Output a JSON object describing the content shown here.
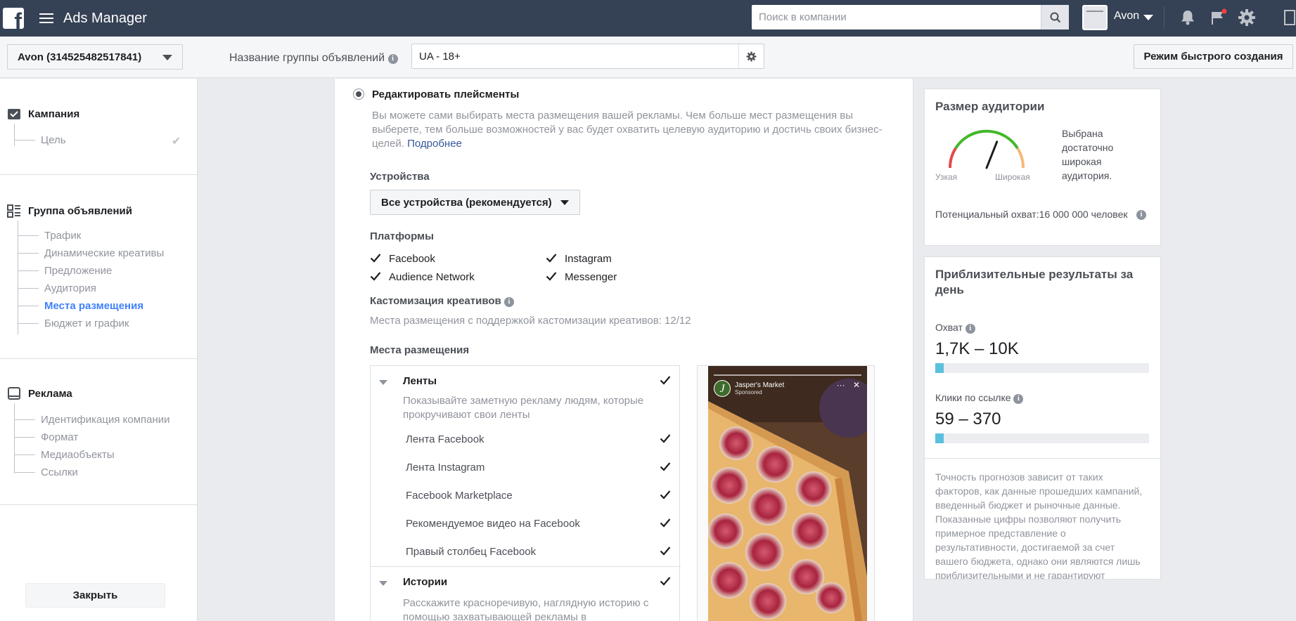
{
  "app": {
    "title": "Ads Manager",
    "search_placeholder": "Поиск в компании",
    "account_name": "Avon"
  },
  "subbar": {
    "account_select": "Avon (314525482517841)",
    "adset_name_label": "Название группы объявлений",
    "adset_name_value": "UA - 18+",
    "quick_create": "Режим быстрого создания"
  },
  "sidebar": {
    "campaign": {
      "title": "Кампания",
      "items": [
        "Цель"
      ]
    },
    "adset": {
      "title": "Группа объявлений",
      "items": [
        "Трафик",
        "Динамические креативы",
        "Предложение",
        "Аудитория",
        "Места размещения",
        "Бюджет и график"
      ],
      "active_index": 4
    },
    "ad": {
      "title": "Реклама",
      "items": [
        "Идентификация компании",
        "Формат",
        "Медиаобъекты",
        "Ссылки"
      ]
    },
    "close_button": "Закрыть"
  },
  "placements": {
    "edit_label": "Редактировать плейсменты",
    "description": "Вы можете сами выбирать места размещения вашей рекламы. Чем больше мест размещения вы выберете, тем больше возможностей у вас будет охватить целевую аудиторию и достичь своих бизнес-целей.",
    "learn_more": "Подробнее",
    "devices_label": "Устройства",
    "devices_value": "Все устройства (рекомендуется)",
    "platforms_label": "Платформы",
    "platforms": [
      {
        "name": "Facebook",
        "checked": true
      },
      {
        "name": "Instagram",
        "checked": true
      },
      {
        "name": "Audience Network",
        "checked": true
      },
      {
        "name": "Messenger",
        "checked": true
      }
    ],
    "custom_label": "Кастомизация креативов",
    "custom_text": "Места размещения с поддержкой кастомизации креативов: 12/12",
    "places_label": "Места размещения",
    "feeds": {
      "title": "Ленты",
      "description": "Показывайте заметную рекламу людям, которые прокручивают свои ленты",
      "items": [
        "Лента Facebook",
        "Лента Instagram",
        "Facebook Marketplace",
        "Рекомендуемое видео на Facebook",
        "Правый столбец Facebook"
      ]
    },
    "stories": {
      "title": "Истории",
      "description": "Расскажите красноречивую, наглядную историю с помощью захватывающей рекламы в"
    },
    "preview": {
      "page_name": "Jasper's Market",
      "sponsored": "Sponsored",
      "avatar_letter": "J"
    }
  },
  "audience": {
    "title": "Размер аудитории",
    "narrow": "Узкая",
    "wide": "Широкая",
    "status": "Выбрана достаточно широкая аудитория.",
    "reach_label": "Потенциальный охват:",
    "reach_value": "16 000 000",
    "reach_unit": "человек",
    "gauge_level": 0.62
  },
  "results": {
    "title": "Приблизительные результаты за день",
    "reach_label": "Охват",
    "reach_value": "1,7K – 10K",
    "reach_fill": 0.04,
    "clicks_label": "Клики по ссылке",
    "clicks_value": "59 – 370",
    "clicks_fill": 0.04,
    "footnote": "Точность прогнозов зависит от таких факторов, как данные прошедших кампаний, введенный бюджет и рыночные данные. Показанные цифры позволяют получить примерное представление о результативности, достигаемой за счет вашего бюджета, однако они являются лишь приблизительными и не гарантируют"
  },
  "colors": {
    "topbar": "#354155",
    "active_link": "#4080ff",
    "bar_fill": "#5bc0de",
    "gauge_red": "#e04b4b",
    "gauge_green": "#42b72a",
    "gauge_orange": "#f5b97a"
  }
}
